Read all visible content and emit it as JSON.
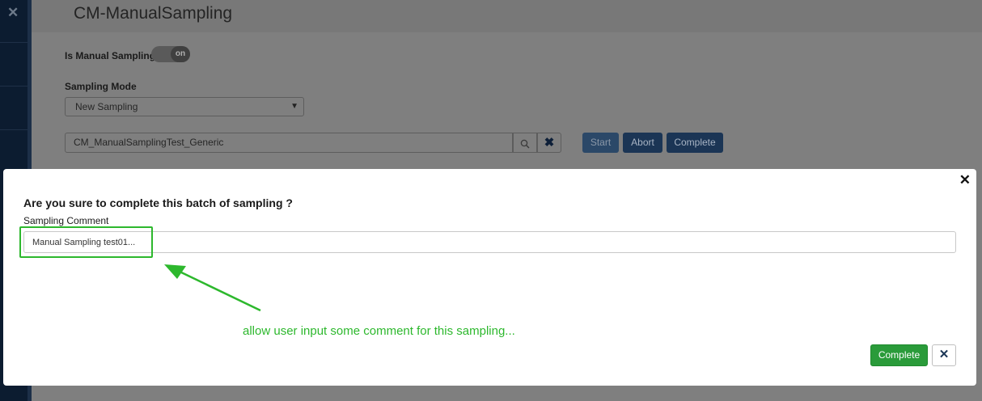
{
  "sidebar": {
    "close_glyph": "✕"
  },
  "page": {
    "title": "CM-ManualSampling",
    "manual_sampling_label": "Is Manual Sampling",
    "toggle_state": "on",
    "sampling_mode_label": "Sampling Mode",
    "sampling_mode_value": "New Sampling",
    "batch_value": "CM_ManualSamplingTest_Generic",
    "buttons": {
      "start": "Start",
      "abort": "Abort",
      "complete": "Complete"
    }
  },
  "modal": {
    "question": "Are you sure to complete this batch of sampling ?",
    "comment_label": "Sampling Comment",
    "comment_value": "Manual Sampling test01...",
    "complete_label": "Complete",
    "close_glyph": "✕",
    "cancel_glyph": "✕"
  },
  "annotation": {
    "text": "allow user input some comment for this sampling...",
    "color": "#2db82d"
  },
  "colors": {
    "accent_dark": "#1b3555",
    "success": "#2a9b3a"
  }
}
